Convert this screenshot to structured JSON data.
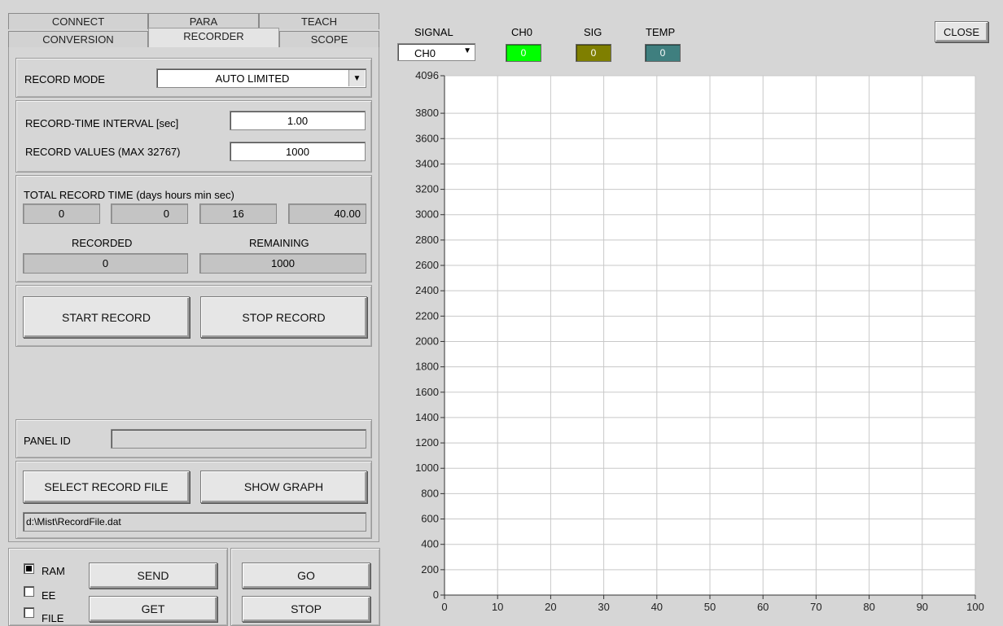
{
  "tabs": {
    "row1": [
      "CONNECT",
      "PARA",
      "TEACH"
    ],
    "row2": [
      "CONVERSION",
      "RECORDER",
      "SCOPE"
    ],
    "active": "RECORDER"
  },
  "record_mode": {
    "label": "RECORD MODE",
    "value": "AUTO LIMITED"
  },
  "interval": {
    "label": "RECORD-TIME INTERVAL [sec]",
    "value": "1.00"
  },
  "values": {
    "label": "RECORD VALUES (MAX 32767)",
    "value": "1000"
  },
  "total_time": {
    "label": "TOTAL RECORD TIME (days  hours  min sec)",
    "days": "0",
    "hours": "0",
    "min": "16",
    "sec": "40.00"
  },
  "recorded": {
    "label": "RECORDED",
    "value": "0"
  },
  "remaining": {
    "label": "REMAINING",
    "value": "1000"
  },
  "buttons": {
    "start_record": "START RECORD",
    "stop_record": "STOP RECORD",
    "select_file": "SELECT RECORD FILE",
    "show_graph": "SHOW GRAPH",
    "send": "SEND",
    "get": "GET",
    "go": "GO",
    "stop": "STOP",
    "close": "CLOSE"
  },
  "panel_id": {
    "label": "PANEL ID",
    "value": ""
  },
  "file_path": "d:\\Mist\\RecordFile.dat",
  "storage": [
    {
      "label": "RAM",
      "checked": true
    },
    {
      "label": "EE",
      "checked": false
    },
    {
      "label": "FILE",
      "checked": false
    }
  ],
  "signal": {
    "label": "SIGNAL",
    "value": "CH0"
  },
  "indicators": [
    {
      "label": "CH0",
      "value": "0",
      "color": "#00ff00"
    },
    {
      "label": "SIG",
      "value": "0",
      "color": "#7f7f00"
    },
    {
      "label": "TEMP",
      "value": "0",
      "color": "#3f7f7f"
    }
  ],
  "chart_data": {
    "type": "line",
    "x": [],
    "series": [],
    "xlim": [
      0,
      100
    ],
    "ylim": [
      0,
      4096
    ],
    "xticks": [
      0,
      10,
      20,
      30,
      40,
      50,
      60,
      70,
      80,
      90,
      100
    ],
    "yticks": [
      0,
      200,
      400,
      600,
      800,
      1000,
      1200,
      1400,
      1600,
      1800,
      2000,
      2200,
      2400,
      2600,
      2800,
      3000,
      3200,
      3400,
      3600,
      3800,
      4096
    ],
    "grid": true
  }
}
